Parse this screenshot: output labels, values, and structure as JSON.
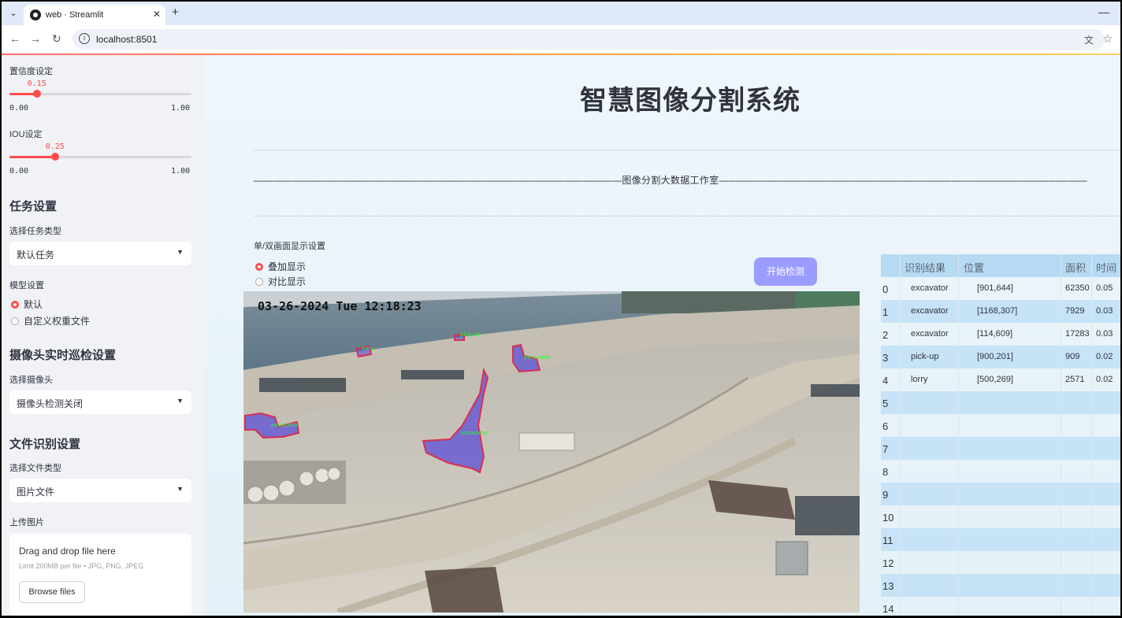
{
  "browser": {
    "tab_title": "web · Streamlit",
    "url": "localhost:8501"
  },
  "sidebar": {
    "confidence": {
      "label": "置信度设定",
      "value": "0.15",
      "value_num": 0.15,
      "min": "0.00",
      "max": "1.00"
    },
    "iou": {
      "label": "IOU设定",
      "value": "0.25",
      "value_num": 0.25,
      "min": "0.00",
      "max": "1.00"
    },
    "task_settings": {
      "heading": "任务设置",
      "select_label": "选择任务类型",
      "selected": "默认任务"
    },
    "model_settings": {
      "label": "模型设置",
      "options": [
        "默认",
        "自定义权重文件"
      ],
      "selected_index": 0
    },
    "camera": {
      "heading": "摄像头实时巡检设置",
      "select_label": "选择摄像头",
      "selected": "摄像头检测关闭"
    },
    "file": {
      "heading": "文件识别设置",
      "select_label": "选择文件类型",
      "selected": "图片文件",
      "upload_label": "上传图片"
    },
    "uploader": {
      "drag_text": "Drag and drop file here",
      "limit_text": "Limit 200MB per file • JPG, PNG, JPEG",
      "browse_label": "Browse files"
    }
  },
  "main": {
    "title": "智慧图像分割系统",
    "studio_line": "——————————————————————————————————————图像分割大数据工作室——————————————————————————————————————",
    "display_mode": {
      "label": "单/双画面显示设置",
      "options": [
        "叠加显示",
        "对比显示"
      ],
      "selected_index": 0
    },
    "start_button": "开始检测",
    "image": {
      "timestamp": "03-26-2024 Tue 12:18:23",
      "detection_labels": [
        "excavator",
        "excavator",
        "excavator",
        "pick-up",
        "lorry"
      ]
    }
  },
  "table": {
    "headers": [
      "识别结果",
      "位置",
      "面积",
      "时间"
    ],
    "rows": [
      {
        "index": "0",
        "result": "excavator",
        "position": "[901,644]",
        "area": "62350",
        "time": "0.05"
      },
      {
        "index": "1",
        "result": "excavator",
        "position": "[1168,307]",
        "area": "7929",
        "time": "0.03"
      },
      {
        "index": "2",
        "result": "excavator",
        "position": "[114,609]",
        "area": "17283",
        "time": "0.03"
      },
      {
        "index": "3",
        "result": "pick-up",
        "position": "[900,201]",
        "area": "909",
        "time": "0.02"
      },
      {
        "index": "4",
        "result": "lorry",
        "position": "[500,269]",
        "area": "2571",
        "time": "0.02"
      },
      {
        "index": "5",
        "result": "",
        "position": "",
        "area": "",
        "time": ""
      },
      {
        "index": "6",
        "result": "",
        "position": "",
        "area": "",
        "time": ""
      },
      {
        "index": "7",
        "result": "",
        "position": "",
        "area": "",
        "time": ""
      },
      {
        "index": "8",
        "result": "",
        "position": "",
        "area": "",
        "time": ""
      },
      {
        "index": "9",
        "result": "",
        "position": "",
        "area": "",
        "time": ""
      },
      {
        "index": "10",
        "result": "",
        "position": "",
        "area": "",
        "time": ""
      },
      {
        "index": "11",
        "result": "",
        "position": "",
        "area": "",
        "time": ""
      },
      {
        "index": "12",
        "result": "",
        "position": "",
        "area": "",
        "time": ""
      },
      {
        "index": "13",
        "result": "",
        "position": "",
        "area": "",
        "time": ""
      },
      {
        "index": "14",
        "result": "",
        "position": "",
        "area": "",
        "time": ""
      }
    ]
  },
  "colors": {
    "accent": "#ff4b4b",
    "button": "#9b9cff",
    "table_header": "#b7daf3",
    "table_stripe": "#c6e3f7"
  }
}
